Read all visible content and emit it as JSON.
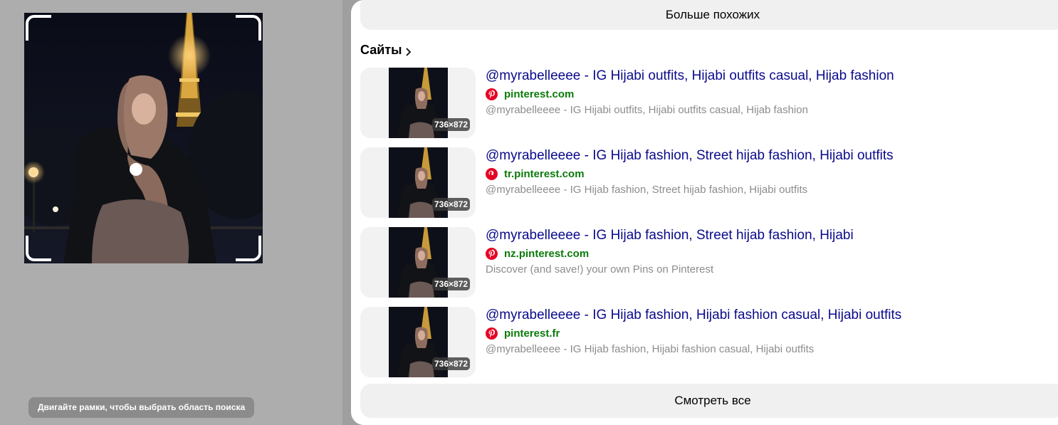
{
  "crop_hint": "Двигайте рамки, чтобы выбрать область поиска",
  "more_similar_label": "Больше похожих",
  "sites": {
    "title": "Сайты",
    "items": [
      {
        "title": "@myrabelleeee - IG Hijabi outfits, Hijabi outfits casual, Hijab fashion",
        "host": "pinterest.com",
        "description": "@myrabelleeee - IG Hijabi outfits, Hijabi outfits casual, Hijab fashion",
        "size": "736×872"
      },
      {
        "title": "@myrabelleeee - IG Hijab fashion, Street hijab fashion, Hijabi outfits",
        "host": "tr.pinterest.com",
        "description": "@myrabelleeee - IG Hijab fashion, Street hijab fashion, Hijabi outfits",
        "size": "736×872"
      },
      {
        "title": "@myrabelleeee - IG Hijab fashion, Street hijab fashion, Hijabi",
        "host": "nz.pinterest.com",
        "description": "Discover (and save!) your own Pins on Pinterest",
        "size": "736×872"
      },
      {
        "title": "@myrabelleeee - IG Hijab fashion, Hijabi fashion casual, Hijabi outfits",
        "host": "pinterest.fr",
        "description": "@myrabelleeee - IG Hijab fashion, Hijabi fashion casual, Hijabi outfits",
        "size": "736×872"
      }
    ]
  },
  "see_all_label": "Смотреть все",
  "icons": {
    "site_icon": "pinterest-icon",
    "section_arrow": "chevron-right-icon"
  },
  "colors": {
    "title_link": "#0a0a8c",
    "host_green": "#0b7a0b",
    "pinterest_red": "#e60023",
    "description_gray": "#8c8c8c"
  }
}
